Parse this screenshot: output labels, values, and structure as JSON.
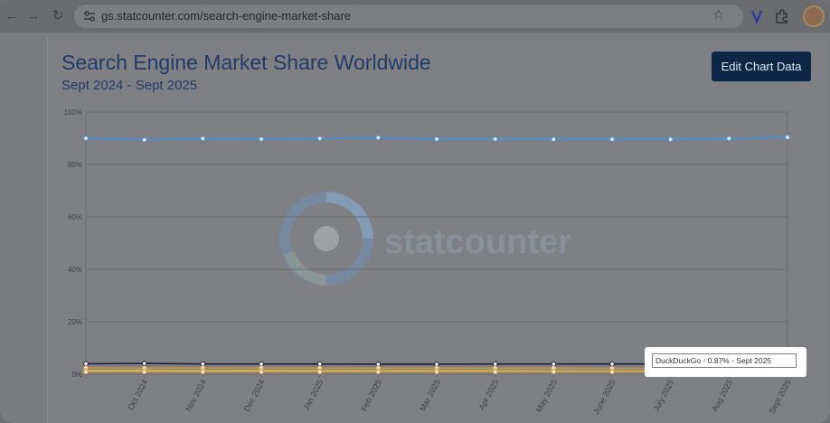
{
  "browser": {
    "url": "gs.statcounter.com/search-engine-market-share",
    "back_label": "←",
    "forward_label": "→",
    "reload_label": "↻",
    "star_label": "☆"
  },
  "page": {
    "title": "Search Engine Market Share Worldwide",
    "subtitle": "Sept 2024 - Sept 2025",
    "edit_button_label": "Edit Chart Data",
    "watermark": "statcounter",
    "tooltip": "DuckDuckGo - 0.87% - Sept 2025"
  },
  "colors": {
    "main_line": "#4d8fd0",
    "dark_line": "#1a1f3c",
    "orange_line": "#c79547",
    "yellow_line": "#d3c44c",
    "grid": "#6a6b6e",
    "axis_text": "#3f4044",
    "title": "#1f3c67"
  },
  "chart_data": {
    "type": "line",
    "ylim": [
      0,
      100
    ],
    "y_ticks": [
      "0%",
      "20%",
      "40%",
      "60%",
      "80%",
      "100%"
    ],
    "categories": [
      "Sept 2024",
      "Oct 2024",
      "Nov 2024",
      "Dec 2024",
      "Jan 2025",
      "Feb 2025",
      "Mar 2025",
      "Apr 2025",
      "May 2025",
      "June 2025",
      "July 2025",
      "Aug 2025",
      "Sept 2025"
    ],
    "x_tick_labels": [
      "",
      "Oct 2024",
      "Nov 2024",
      "Dec 2024",
      "Jan 2025",
      "Feb 2025",
      "Mar 2025",
      "Apr 2025",
      "May 2025",
      "June 2025",
      "July 2025",
      "Aug 2025",
      "Sept 2025"
    ],
    "series": [
      {
        "values": [
          90.0,
          89.4,
          89.9,
          89.7,
          89.9,
          90.2,
          89.7,
          89.7,
          89.6,
          89.6,
          89.6,
          89.9,
          90.4
        ]
      },
      {
        "values": [
          4.0,
          4.1,
          3.9,
          3.9,
          3.9,
          3.8,
          3.8,
          3.9,
          3.9,
          3.9,
          3.9,
          3.8,
          3.6
        ]
      },
      {
        "values": [
          2.4,
          2.3,
          2.4,
          2.4,
          2.3,
          2.3,
          2.3,
          2.3,
          2.3,
          2.2,
          2.2,
          2.2,
          2.1
        ]
      },
      {
        "values": [
          1.4,
          1.4,
          1.3,
          1.4,
          1.3,
          1.3,
          1.3,
          1.3,
          1.2,
          1.2,
          1.2,
          1.2,
          1.2
        ]
      },
      {
        "values": [
          0.9,
          0.9,
          0.9,
          0.9,
          0.9,
          0.9,
          0.9,
          0.9,
          0.9,
          0.9,
          0.9,
          0.9,
          0.87
        ]
      }
    ]
  }
}
